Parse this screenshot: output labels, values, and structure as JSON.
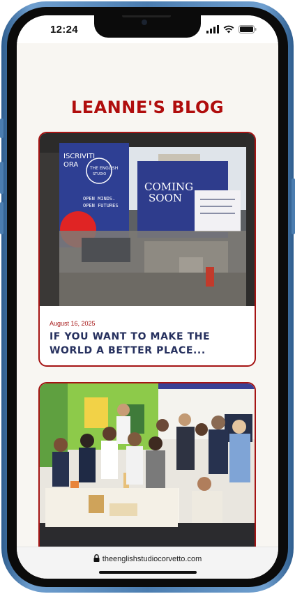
{
  "status_bar": {
    "time": "12:24"
  },
  "page": {
    "title": "LEANNE'S BLOG"
  },
  "posts": [
    {
      "date": "August 16, 2025",
      "title": "IF YOU WANT TO MAKE THE WORLD A BETTER PLACE..."
    },
    {
      "date": "",
      "title": ""
    }
  ],
  "photo1_signage": {
    "left_panel": "ISCRIVITI ORA",
    "logo": "THE ENGLISH STUDIO",
    "slogan": "OPEN MINDS. OPEN FUTURES",
    "right_panel": "COMING SOON"
  },
  "browser": {
    "url": "theenglishstudiocorvetto.com"
  },
  "colors": {
    "accent": "#a51414",
    "title_red": "#b00d0d",
    "post_title": "#26305e",
    "bezel_blue": "#4b7db0"
  },
  "icons": [
    "signal-icon",
    "wifi-icon",
    "battery-icon",
    "lock-icon"
  ]
}
